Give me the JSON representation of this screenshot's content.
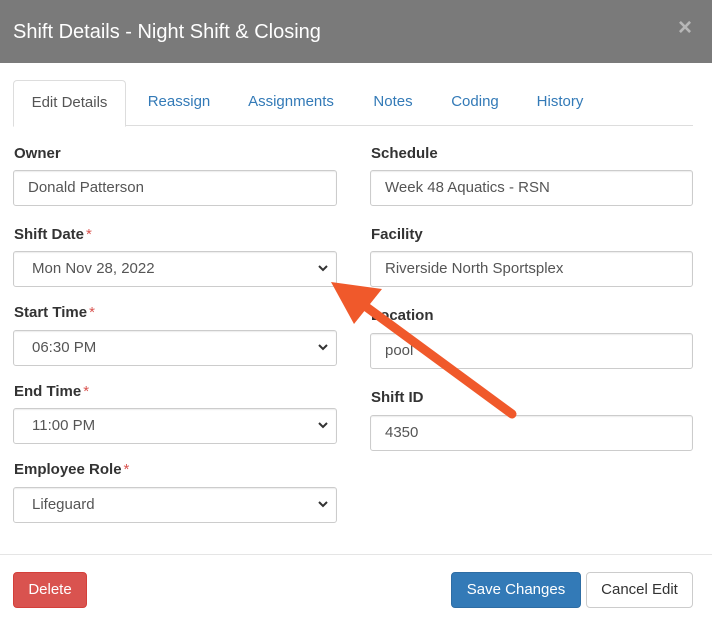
{
  "modal": {
    "title": "Shift Details - Night Shift & Closing",
    "close_label": "×"
  },
  "tabs": [
    {
      "label": "Edit Details",
      "active": true
    },
    {
      "label": "Reassign",
      "active": false
    },
    {
      "label": "Assignments",
      "active": false
    },
    {
      "label": "Notes",
      "active": false
    },
    {
      "label": "Coding",
      "active": false
    },
    {
      "label": "History",
      "active": false
    }
  ],
  "form": {
    "owner": {
      "label": "Owner",
      "value": "Donald Patterson"
    },
    "shift_date": {
      "label": "Shift Date",
      "required": "*",
      "value": "Mon Nov 28, 2022"
    },
    "start_time": {
      "label": "Start Time",
      "required": "*",
      "value": "06:30 PM"
    },
    "end_time": {
      "label": "End Time",
      "required": "*",
      "value": "11:00 PM"
    },
    "employee_role": {
      "label": "Employee Role",
      "required": "*",
      "value": "Lifeguard"
    },
    "schedule": {
      "label": "Schedule",
      "value": "Week 48 Aquatics - RSN"
    },
    "facility": {
      "label": "Facility",
      "value": "Riverside North Sportsplex"
    },
    "location": {
      "label": "Location",
      "value": "pool"
    },
    "shift_id": {
      "label": "Shift ID",
      "value": "4350"
    }
  },
  "footer": {
    "delete_label": "Delete",
    "save_label": "Save Changes",
    "cancel_label": "Cancel Edit"
  },
  "annotation": {
    "arrow_color": "#f0592b",
    "icon": "pointer-arrow-icon"
  },
  "colors": {
    "header_bg": "#7a7a7a",
    "link": "#337ab7",
    "danger": "#d9534f",
    "primary": "#337ab7"
  }
}
